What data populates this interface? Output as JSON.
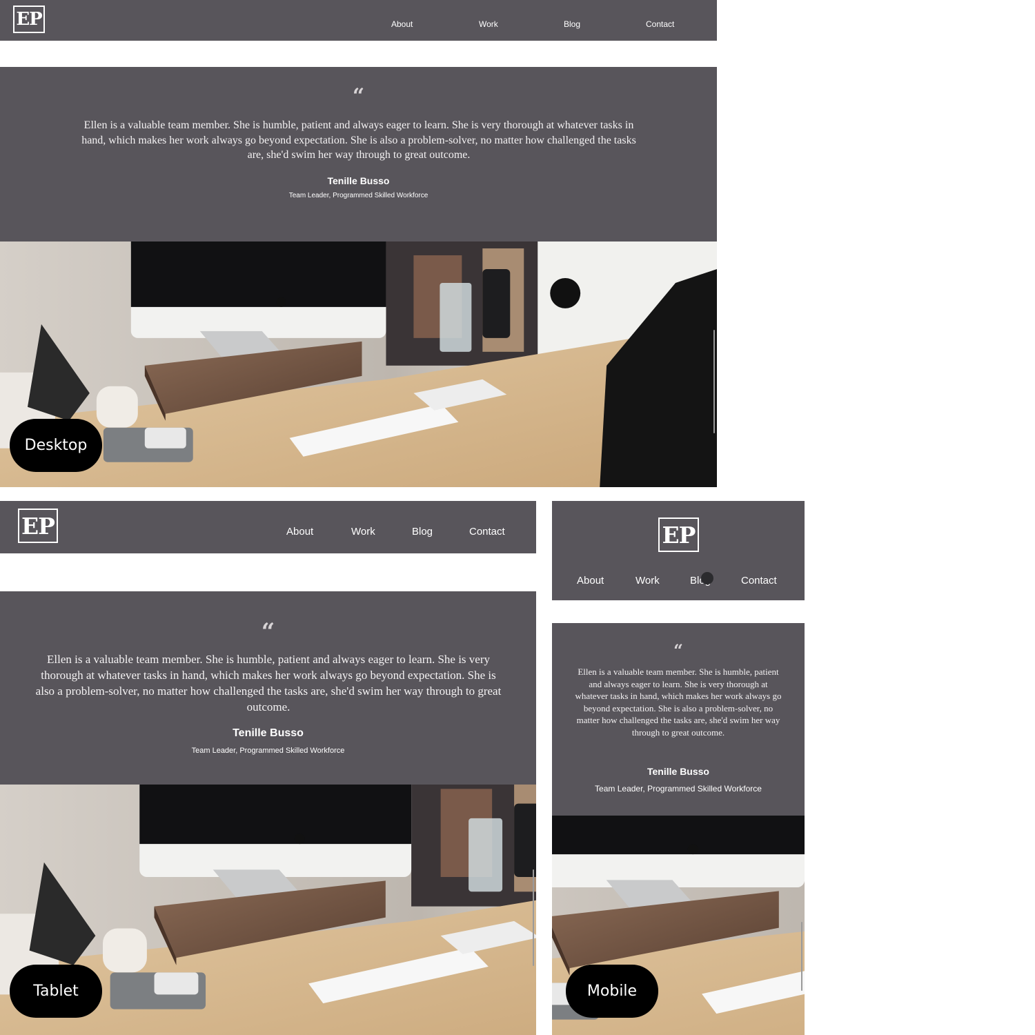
{
  "brand": {
    "logo": "EP"
  },
  "nav": [
    "About",
    "Work",
    "Blog",
    "Contact"
  ],
  "testimonial": {
    "quote_mark": "“",
    "text": "Ellen is a valuable team member. She is humble, patient and always eager to learn. She is very thorough at whatever tasks in hand, which makes her work always go beyond expectation. She is also a problem-solver, no matter how challenged the tasks are, she'd swim her way through to great outcome.",
    "name": "Tenille Busso",
    "role": "Team Leader, Programmed Skilled Workforce"
  },
  "labels": {
    "desktop": "Desktop",
    "tablet": "Tablet",
    "mobile": "Mobile"
  },
  "colors": {
    "panel": "#58555b",
    "badge": "#000000",
    "text": "#ffffff"
  }
}
